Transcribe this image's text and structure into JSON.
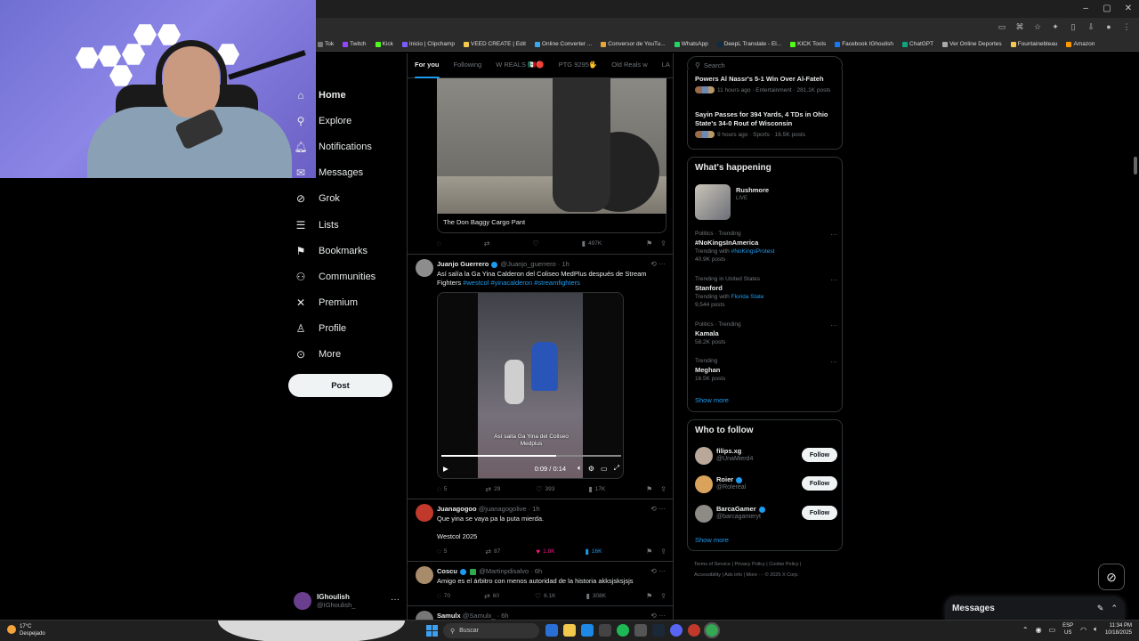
{
  "browser": {
    "window_controls": [
      "–",
      "▢",
      "✕"
    ],
    "bookmarks": [
      "Tok",
      "Twitch",
      "Kick",
      "Inicio | Clipchamp",
      "VEED CREATE | Edit",
      "Online Converter ...",
      "Conversor de YouTu...",
      "WhatsApp",
      "DeepL Translate - El...",
      "KICK Tools",
      "Facebook IGhoulish",
      "ChatGPT",
      "Ver Online Deportes",
      "Fountainebleau",
      "Amazon"
    ]
  },
  "nav": {
    "items": [
      {
        "label": "Home",
        "icon": "home-icon"
      },
      {
        "label": "Explore",
        "icon": "search-icon"
      },
      {
        "label": "Notifications",
        "icon": "bell-icon"
      },
      {
        "label": "Messages",
        "icon": "envelope-icon"
      },
      {
        "label": "Grok",
        "icon": "grok-icon"
      },
      {
        "label": "Lists",
        "icon": "list-icon"
      },
      {
        "label": "Bookmarks",
        "icon": "bookmark-icon"
      },
      {
        "label": "Communities",
        "icon": "people-icon"
      },
      {
        "label": "Premium",
        "icon": "x-logo-icon"
      },
      {
        "label": "Profile",
        "icon": "person-icon"
      },
      {
        "label": "More",
        "icon": "more-circle-icon"
      }
    ],
    "post_label": "Post",
    "account": {
      "name": "IGhoulish",
      "handle": "@IGhoulish_"
    }
  },
  "feed": {
    "tabs": [
      "For you",
      "Following",
      "W REALS 🇲🇽🔴",
      "PTG 9295🖐",
      "Old Reals w",
      "LA"
    ],
    "media_caption": "The Don Baggy Cargo Pant",
    "media_actions": {
      "views": "497K"
    },
    "tweets": [
      {
        "name": "Juanjo Guerrero",
        "handle": "@Juanjo_guerrero",
        "time": "· 1h",
        "text": "Así salía la Ga Yina Calderon del Coliseo MedPlus después de Stream Fighters",
        "hashtags": "#westcol #yinacalderon #streamfighters",
        "video_subtitle": "Así salía Ga Yina del Coliseo Medplus",
        "video_time": "0:09 / 0:14",
        "video_progress": 0.64,
        "replies": "5",
        "reposts": "29",
        "likes": "393",
        "views": "17K"
      },
      {
        "name": "Juanagogoo",
        "handle": "@juanagogolive",
        "time": "· 1h",
        "text": "Que yina se vaya pa la puta mierda.",
        "text2": "Westcol 2025",
        "replies": "5",
        "reposts": "87",
        "likes": "1.8K",
        "views": "16K"
      },
      {
        "name": "Coscu",
        "handle": "@Martinpdisalvo",
        "time": "· 6h",
        "text": "Amigo es el árbitro con menos autoridad de la historia akksjsksjsjs",
        "replies": "70",
        "reposts": "60",
        "likes": "6.1K",
        "views": "308K"
      },
      {
        "name": "Samulx",
        "handle": "@Samulx_",
        "time": "· 6h"
      }
    ]
  },
  "sidebar": {
    "search_placeholder": "Search",
    "news": [
      {
        "title": "Powers Al Nassr's 5-1 Win Over Al-Fateh",
        "meta": "11 hours ago · Entertainment · 281.1K posts"
      },
      {
        "title": "Sayin Passes for 394 Yards, 4 TDs in Ohio State's 34-0 Rout of Wisconsin",
        "meta": "9 hours ago · Sports · 16.5K posts"
      }
    ],
    "happening": {
      "title": "What's happening",
      "live": {
        "name": "Rushmore",
        "badge": "LIVE"
      },
      "trends": [
        {
          "category": "Politics · Trending",
          "name": "#NoKingsInAmerica",
          "sub_prefix": "Trending with",
          "sub_link": "#NoKingsProtest",
          "posts": "40.9K posts"
        },
        {
          "category": "Trending in United States",
          "name": "Stanford",
          "sub_prefix": "Trending with",
          "sub_link": "Florida State",
          "posts": "9,544 posts"
        },
        {
          "category": "Politics · Trending",
          "name": "Kamala",
          "posts": "58.2K posts"
        },
        {
          "category": "Trending",
          "name": "Meghan",
          "posts": "16.5K posts"
        }
      ],
      "show_more": "Show more"
    },
    "who_to_follow": {
      "title": "Who to follow",
      "accounts": [
        {
          "name": "filips.xg",
          "handle": "@UnaMierd4",
          "button": "Follow"
        },
        {
          "name": "Roier",
          "handle": "@Rolereal",
          "button": "Follow"
        },
        {
          "name": "BarcaGamer",
          "handle": "@barcagameryt",
          "button": "Follow"
        }
      ],
      "show_more": "Show more"
    },
    "footer": [
      "Terms of Service",
      "Privacy Policy",
      "Cookie Policy",
      "Accessibility",
      "Ads info",
      "More ···",
      "© 2025 X Corp."
    ]
  },
  "messages_dock": {
    "title": "Messages"
  },
  "taskbar": {
    "temp": "17°C",
    "weather": "Despejado",
    "search": "Buscar",
    "lang1": "ESP",
    "lang2": "US",
    "time": "11:34 PM",
    "date": "10/18/2025"
  },
  "colors": {
    "accent": "#1d9bf0",
    "like": "#f91880",
    "bg": "#000000",
    "border": "#2f3336"
  }
}
